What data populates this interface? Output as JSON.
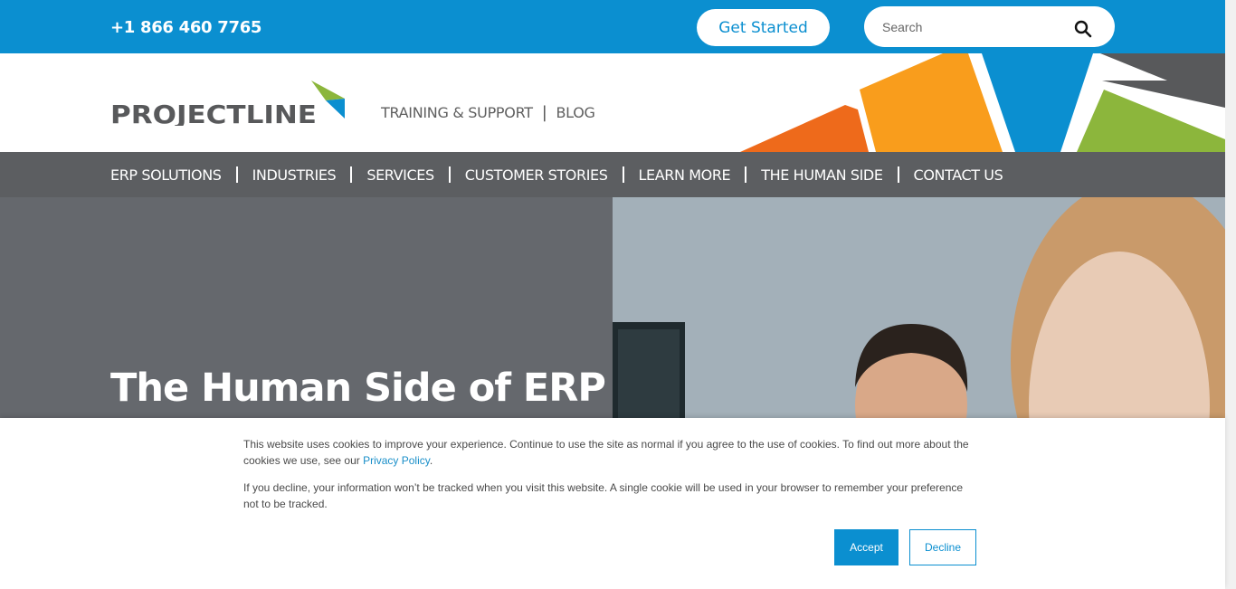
{
  "topbar": {
    "phone": "+1 866 460 7765",
    "get_started_label": "Get Started",
    "search_placeholder": "Search"
  },
  "header": {
    "logo_text": "PROJECTLINE",
    "utility_nav": [
      "TRAINING & SUPPORT",
      "BLOG"
    ]
  },
  "main_nav": {
    "items": [
      "ERP SOLUTIONS",
      "INDUSTRIES",
      "SERVICES",
      "CUSTOMER STORIES",
      "LEARN MORE",
      "THE HUMAN SIDE",
      "CONTACT US"
    ]
  },
  "hero": {
    "title": "The Human Side of ERP"
  },
  "cookie_banner": {
    "text1_before_link": "This website uses cookies to improve your experience. Continue to use the site as normal if you agree to the use of cookies. To find out more about the cookies we use, see our ",
    "privacy_link": "Privacy Policy",
    "text1_after_link": ".",
    "text2": "If you decline, your information won’t be tracked when you visit this website. A single cookie will be used in your browser to remember your preference not to be tracked.",
    "accept_label": "Accept",
    "decline_label": "Decline"
  },
  "colors": {
    "brand_blue": "#0b8fd0",
    "nav_gray": "#5c5e61",
    "hero_gray": "#65686d",
    "orange_dark": "#ee6a1b",
    "orange": "#f99d1c",
    "green": "#8cb63c",
    "dark_gray": "#58595b"
  }
}
